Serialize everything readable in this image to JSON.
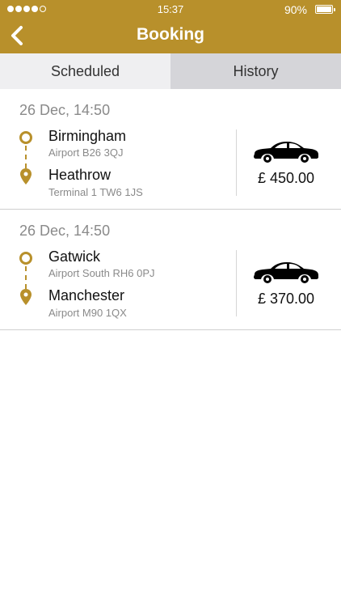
{
  "status_bar": {
    "time": "15:37",
    "battery": "90%",
    "battery_level": 0.9,
    "signal_filled": 4,
    "signal_total": 5
  },
  "header": {
    "title": "Booking",
    "back_icon": "chevron-left-icon"
  },
  "tabs": [
    {
      "label": "Scheduled",
      "active": true
    },
    {
      "label": "History",
      "active": false
    }
  ],
  "bookings": [
    {
      "date": "26 Dec, 14:50",
      "from": {
        "name": "Birmingham",
        "address": "Airport B26 3QJ"
      },
      "to": {
        "name": "Heathrow",
        "address": "Terminal 1 TW6 1JS"
      },
      "vehicle_icon": "car-icon",
      "price": "£ 450.00"
    },
    {
      "date": "26 Dec, 14:50",
      "from": {
        "name": "Gatwick",
        "address": "Airport South RH6 0PJ"
      },
      "to": {
        "name": "Manchester",
        "address": "Airport M90 1QX"
      },
      "vehicle_icon": "car-icon",
      "price": "£ 370.00"
    }
  ],
  "colors": {
    "accent": "#b8902b",
    "tab_active_bg": "#efeff1",
    "tab_inactive_bg": "#d5d5d9"
  }
}
